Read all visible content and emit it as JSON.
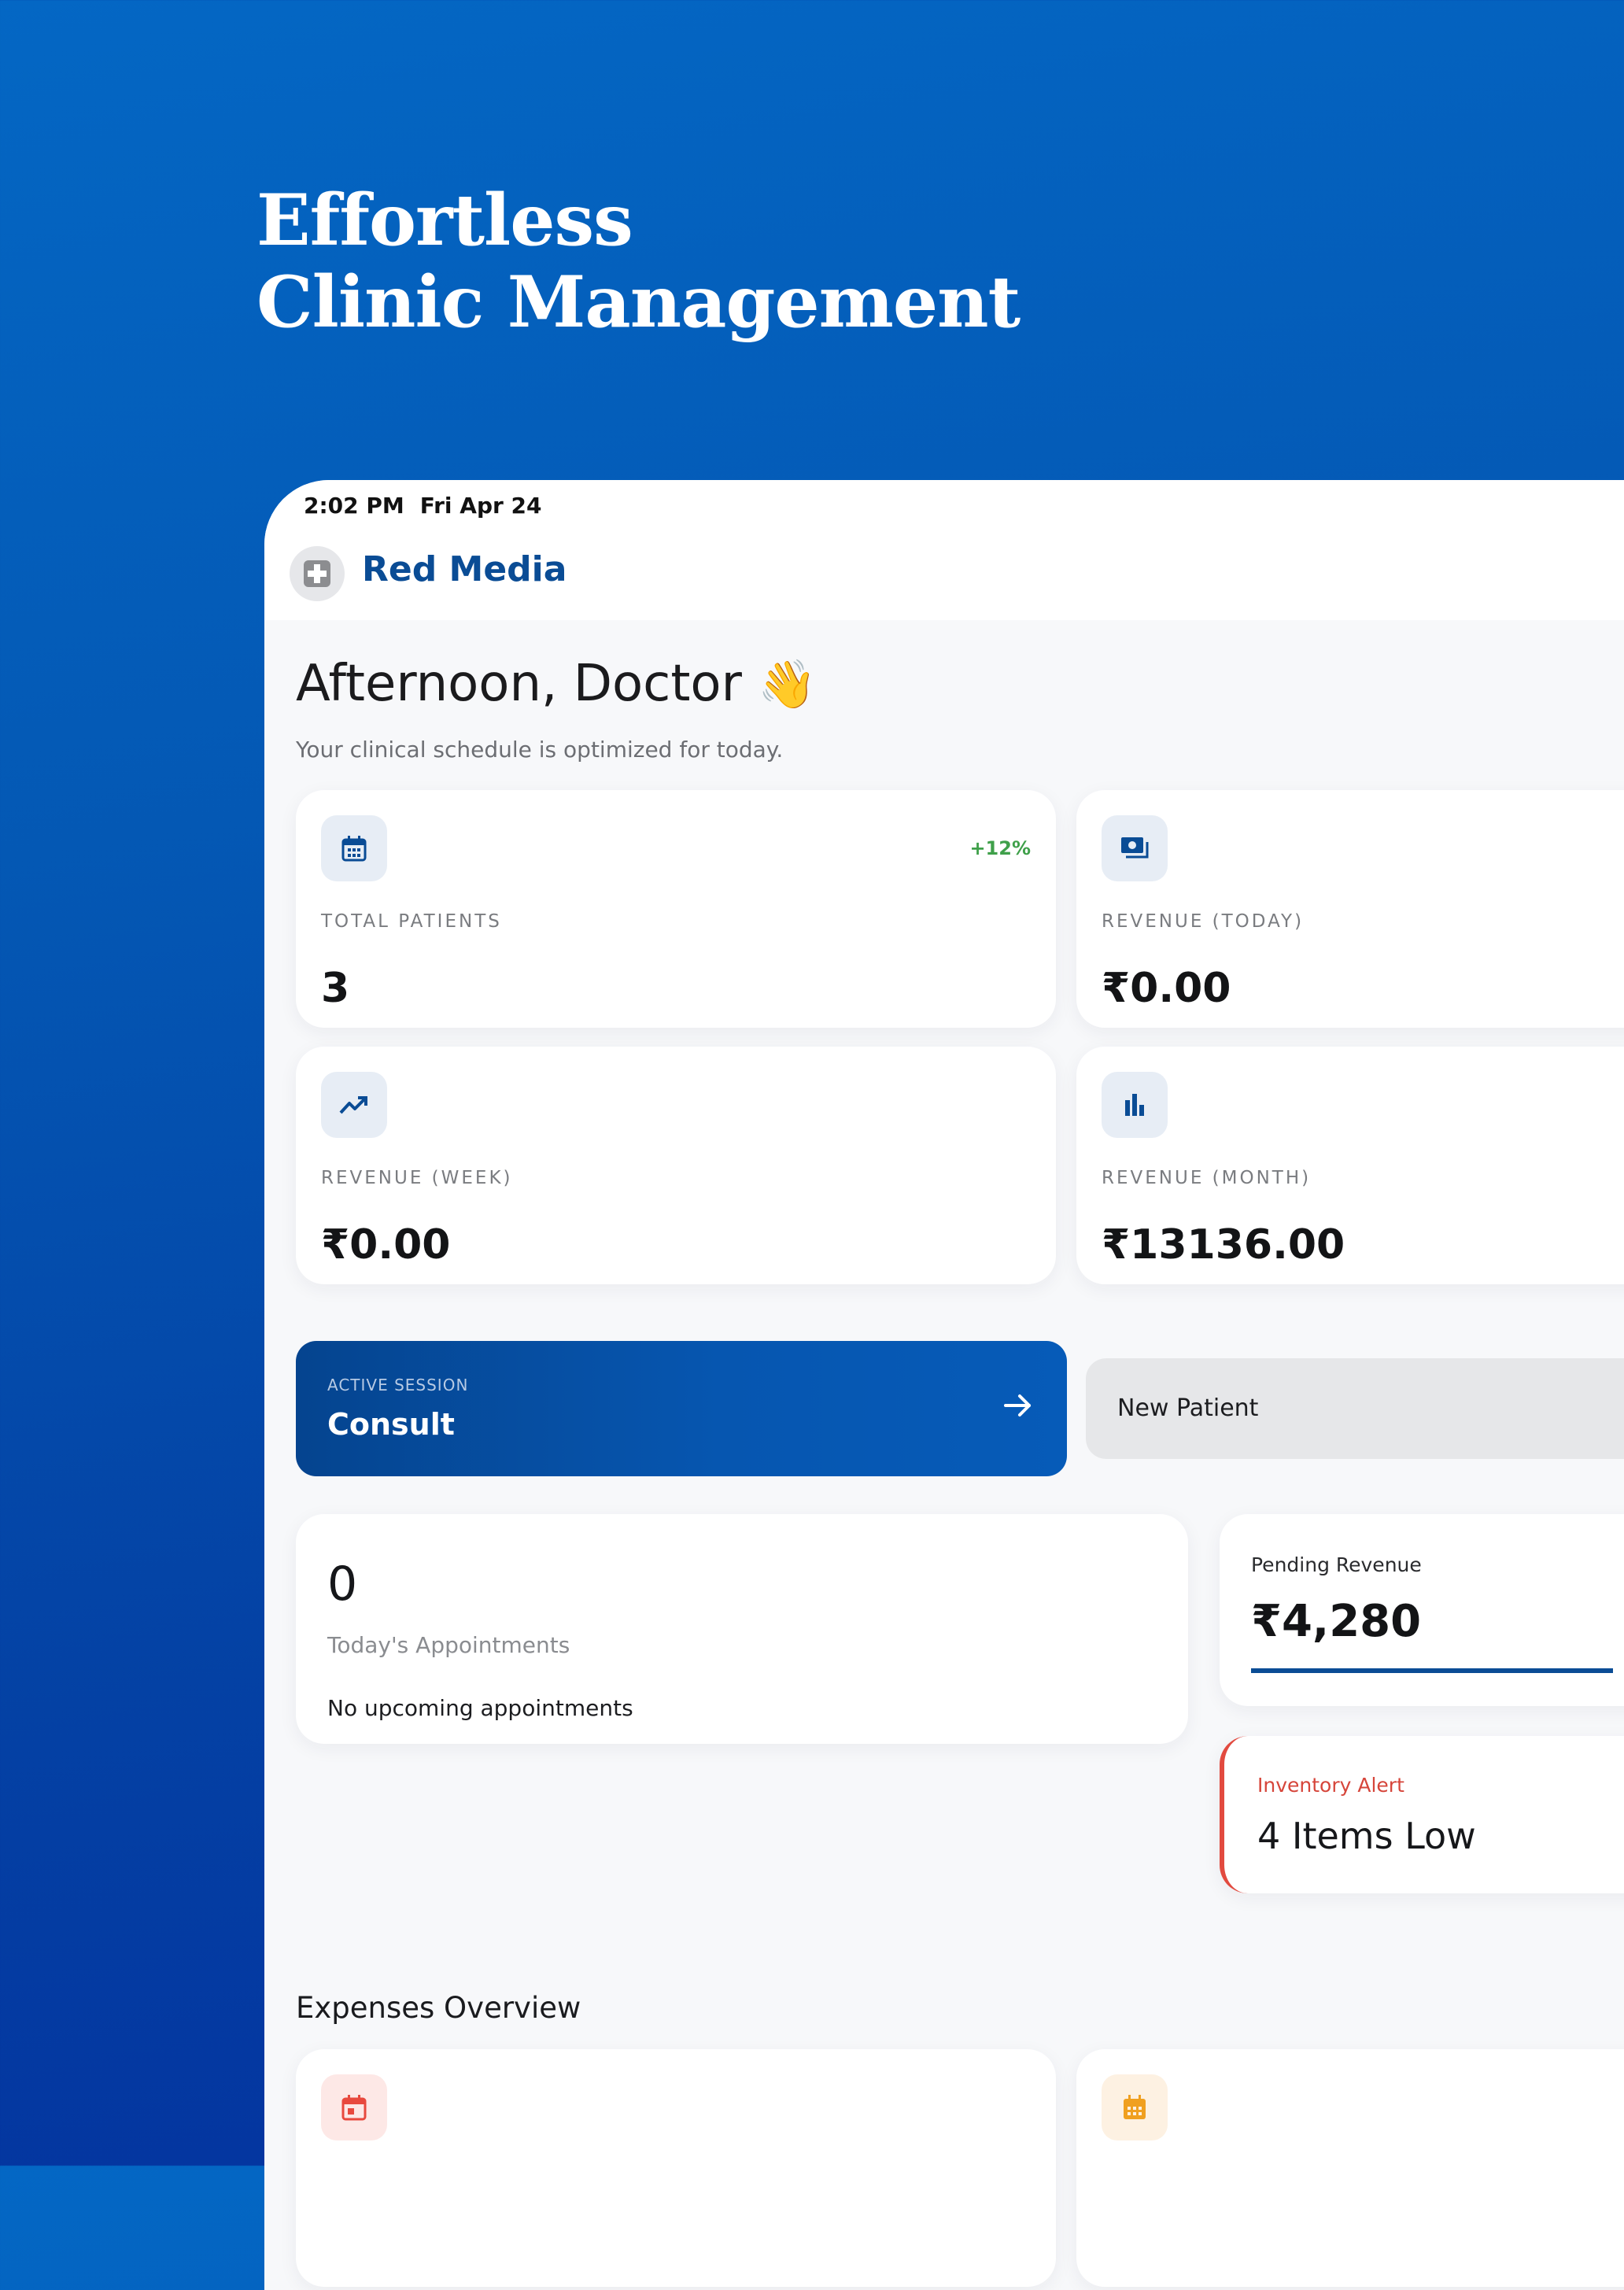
{
  "hero": {
    "line1": "Effortless",
    "line2": "Clinic Management"
  },
  "status_bar": {
    "time": "2:02 PM",
    "date": "Fri Apr 24"
  },
  "brand": {
    "name": "Red Media",
    "logo_icon": "medical-cross-icon"
  },
  "greeting": {
    "title": "Afternoon, Doctor",
    "emoji": "👋",
    "subtitle": "Your clinical schedule is optimized for today."
  },
  "stats": [
    {
      "label": "TOTAL PATIENTS",
      "value": "3",
      "trend": "+12%",
      "icon": "calendar-icon"
    },
    {
      "label": "REVENUE (TODAY)",
      "value": "₹0.00",
      "icon": "cash-icon"
    },
    {
      "label": "REVENUE (WEEK)",
      "value": "₹0.00",
      "icon": "trending-up-icon"
    },
    {
      "label": "REVENUE (MONTH)",
      "value": "₹13136.00",
      "icon": "bar-chart-icon"
    }
  ],
  "actions": {
    "consult_caption": "ACTIVE SESSION",
    "consult_label": "Consult",
    "new_patient_label": "New Patient"
  },
  "appointments": {
    "count": "0",
    "label": "Today's Appointments",
    "empty_text": "No upcoming appointments"
  },
  "pending": {
    "label": "Pending Revenue",
    "value": "₹4,280"
  },
  "inventory": {
    "label": "Inventory Alert",
    "value": "4 Items Low"
  },
  "expenses": {
    "title": "Expenses Overview"
  },
  "colors": {
    "brand": "#0a4c95",
    "positive": "#3fa04a",
    "alert": "#e24a3f",
    "expense_red": "#e8493e",
    "expense_orange": "#f0a020"
  }
}
